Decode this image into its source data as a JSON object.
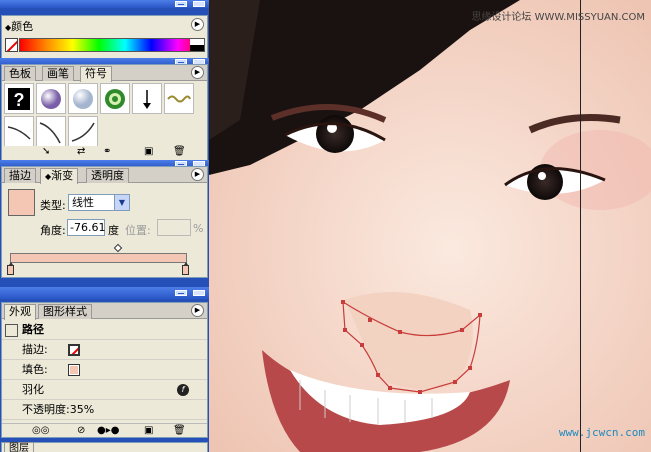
{
  "color_panel": {
    "title": "颜色"
  },
  "symbols_panel": {
    "tabs": [
      "色板",
      "画笔",
      "符号"
    ],
    "active_tab": 2,
    "symbols": [
      "question-icon",
      "purple-sphere-icon",
      "pearl-sphere-icon",
      "green-ring-icon",
      "arrow-down-icon",
      "chain-icon",
      "brush-curve-1-icon",
      "brush-curve-2-icon",
      "brush-curve-3-icon"
    ]
  },
  "gradient_panel": {
    "tabs": [
      "描边",
      "渐变",
      "透明度"
    ],
    "active_tab": 1,
    "type_label": "类型:",
    "type_value": "线性",
    "angle_label": "角度:",
    "angle_value": "-76.61",
    "angle_unit": "度",
    "position_label": "位置:",
    "position_value": "",
    "percent": "%",
    "swatch_color": "#f4c7b4"
  },
  "appearance_panel": {
    "tabs": [
      "外观",
      "图形样式"
    ],
    "active_tab": 0,
    "header": "路径",
    "stroke_label": "描边:",
    "fill_label": "填色:",
    "feather_label": "羽化",
    "opacity_label": "不透明度:35%"
  },
  "layers_panel": {
    "tab": "图层"
  },
  "canvas": {
    "watermark_top": "思缘设计论坛 WWW.MISSYUAN.COM",
    "watermark_bottom": "www.jcwcn.com"
  },
  "colors": {
    "title_bar": "#2550b8",
    "panel_bg": "#ece9d8",
    "skin": "#f4c7b4",
    "path": "#d04040"
  }
}
